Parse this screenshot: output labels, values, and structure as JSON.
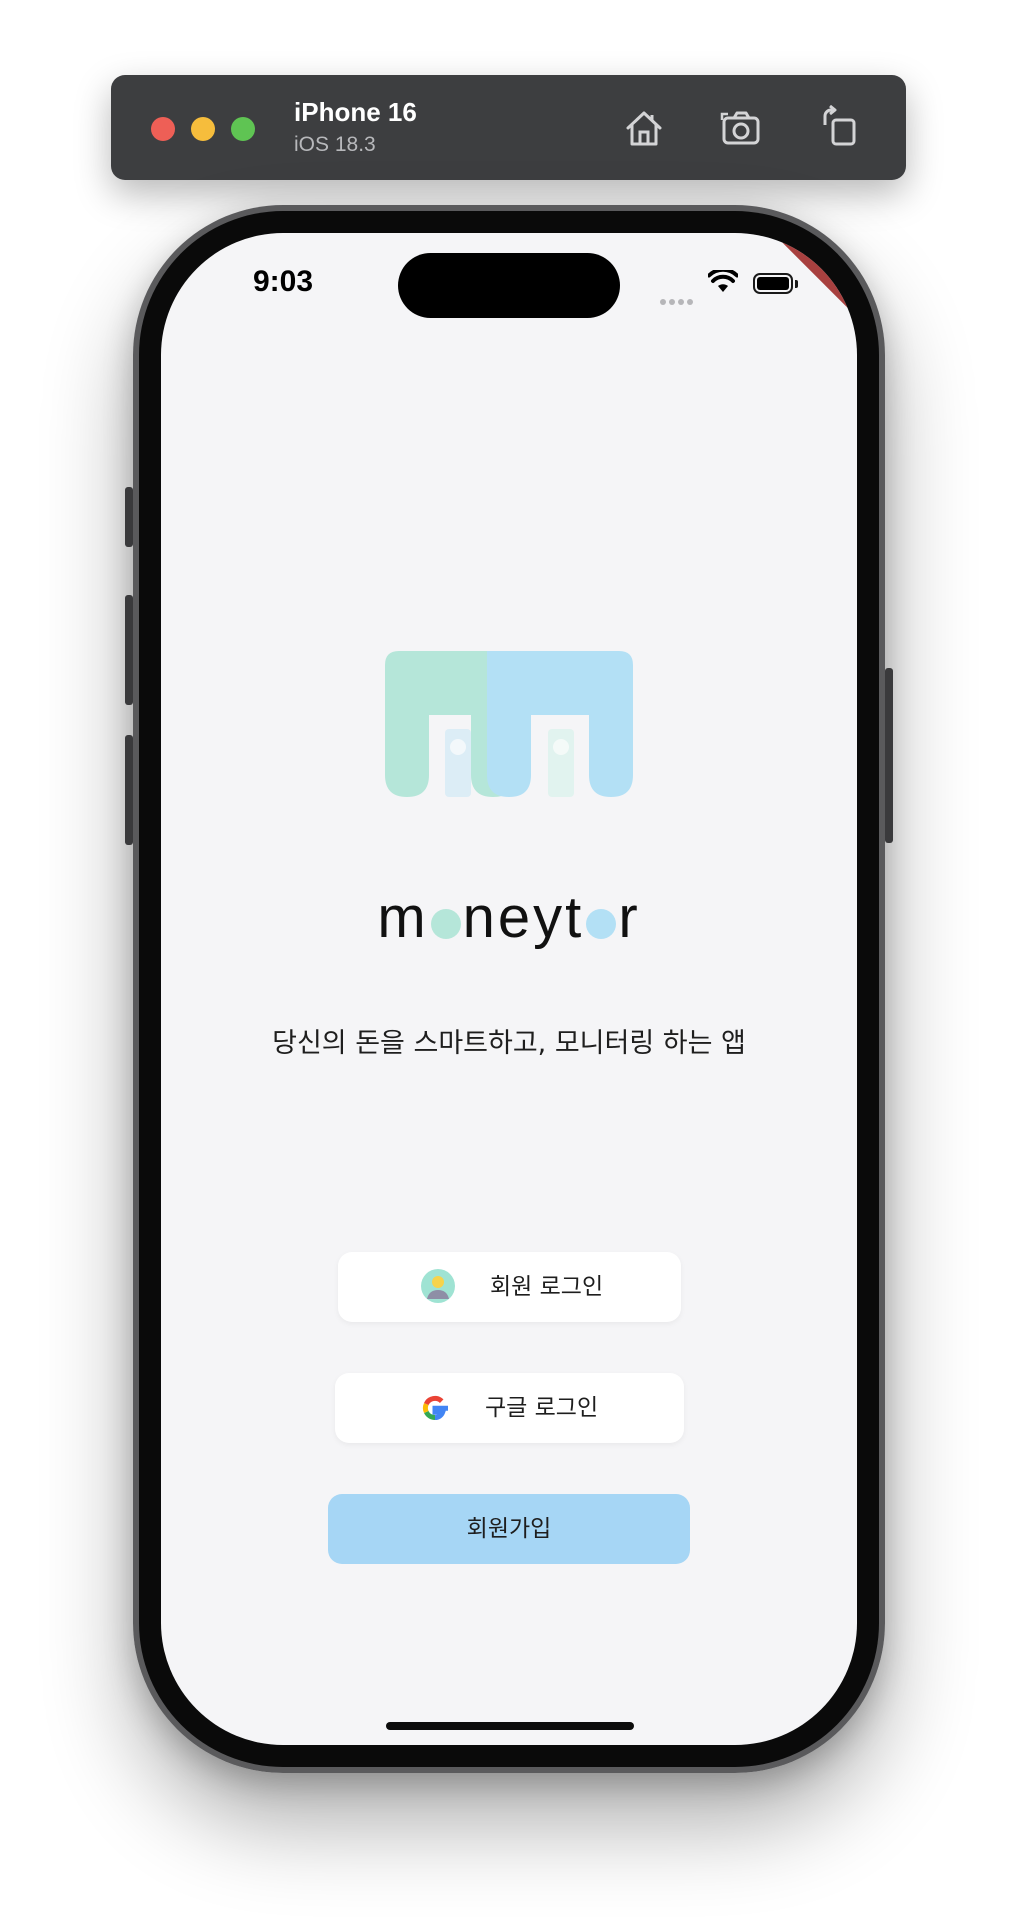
{
  "simulator": {
    "device_name": "iPhone 16",
    "os_version": "iOS 18.3",
    "icons": [
      "home-icon",
      "screenshot-icon",
      "rotate-icon"
    ],
    "traffic_lights": [
      "#ee5f56",
      "#f6bd3c",
      "#5fc453"
    ]
  },
  "status_bar": {
    "time": "9:03",
    "debug_banner": "DEBUG"
  },
  "app": {
    "wordmark": {
      "part1": "m",
      "part2": "neyt",
      "part3": "r",
      "accent_colors": [
        "#b5e6d9",
        "#b3e0f5"
      ]
    },
    "tagline": "당신의 돈을 스마트하고, 모니터링 하는 앱",
    "buttons": {
      "member_login": "회원 로그인",
      "google_login": "구글 로그인",
      "signup": "회원가입"
    },
    "colors": {
      "background": "#f5f5f7",
      "logo_mint": "#b5e6d9",
      "logo_sky": "#b3e0f5",
      "signup_fill": "#a6d6f5"
    }
  }
}
